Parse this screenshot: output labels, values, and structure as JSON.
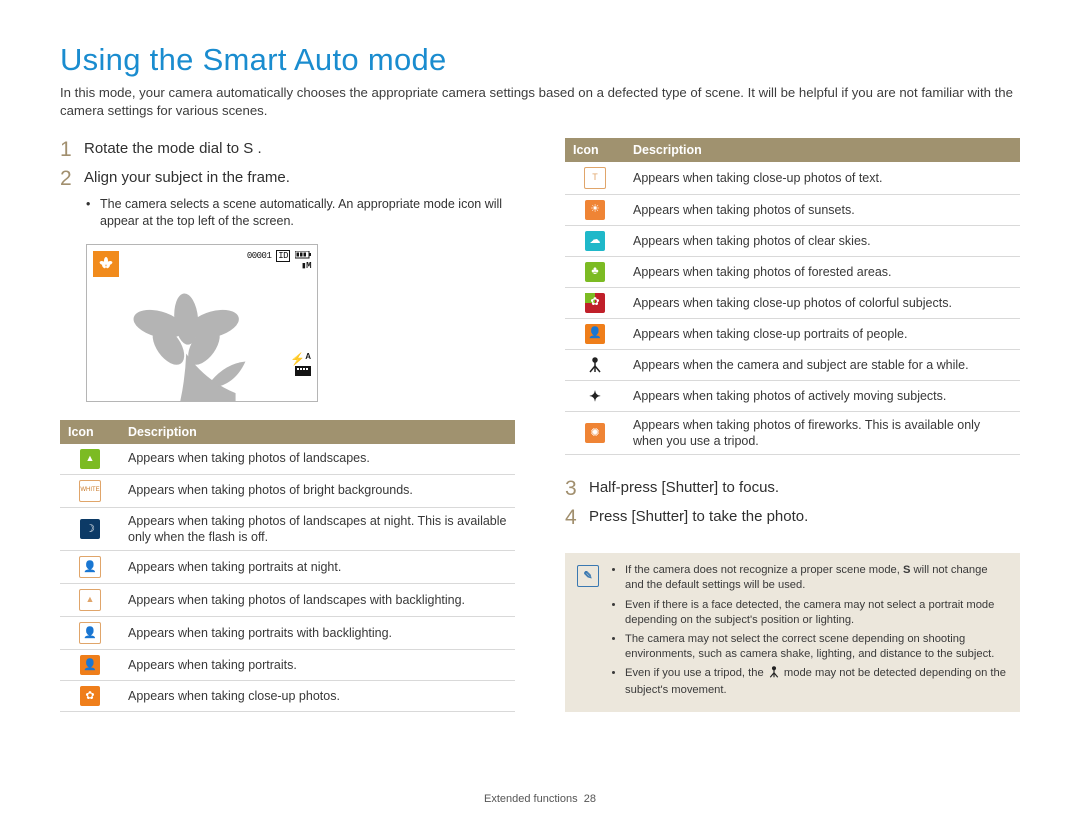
{
  "title": "Using the Smart Auto mode",
  "intro": "In this mode, your camera automatically chooses the appropriate camera settings based on a defected type of scene. It will be helpful if you are not familiar with the camera settings for various scenes.",
  "steps": {
    "1": "Rotate the mode dial to S .",
    "2": "Align your subject in the frame.",
    "2_sub": "The camera selects a scene automatically. An appropriate mode icon will appear at the top left of the screen.",
    "3": "Half-press [Shutter] to focus.",
    "4": "Press [Shutter] to take the photo."
  },
  "preview": {
    "topright_line1": "00001",
    "rightmid": "",
    "flash_label": "A"
  },
  "table": {
    "headers": {
      "icon": "Icon",
      "desc": "Description"
    }
  },
  "left_rows": [
    "Appears when taking photos of landscapes.",
    "Appears when taking photos of bright backgrounds.",
    "Appears when taking photos of landscapes at night. This is available only when the flash is off.",
    "Appears when taking portraits at night.",
    "Appears when taking photos of landscapes with backlighting.",
    "Appears when taking portraits with backlighting.",
    "Appears when taking portraits.",
    "Appears when taking close-up photos."
  ],
  "right_rows": [
    "Appears when taking close-up photos of text.",
    "Appears when taking photos of sunsets.",
    "Appears when taking photos of clear skies.",
    "Appears when taking photos of forested areas.",
    "Appears when taking close-up photos of colorful subjects.",
    "Appears when taking close-up portraits of people.",
    "Appears when the camera and subject are stable for a while.",
    "Appears when taking photos of actively moving subjects.",
    "Appears when taking photos of fireworks. This is available only when you use a tripod."
  ],
  "notes": {
    "n1_pre": "If the camera does not recognize a proper scene mode, ",
    "n1_bold": "S",
    "n1_post": " will not change and the default settings will be used.",
    "n2": "Even if there is a face detected, the camera may not select a portrait mode depending on the subject's position or lighting.",
    "n3": "The camera may not select the correct scene depending on shooting environments, such as camera shake, lighting, and distance to the subject.",
    "n4_pre": "Even if you use a tripod, the ",
    "n4_post": " mode may not be detected depending on the subject's movement."
  },
  "footer": {
    "section": "Extended functions",
    "page": "28"
  }
}
